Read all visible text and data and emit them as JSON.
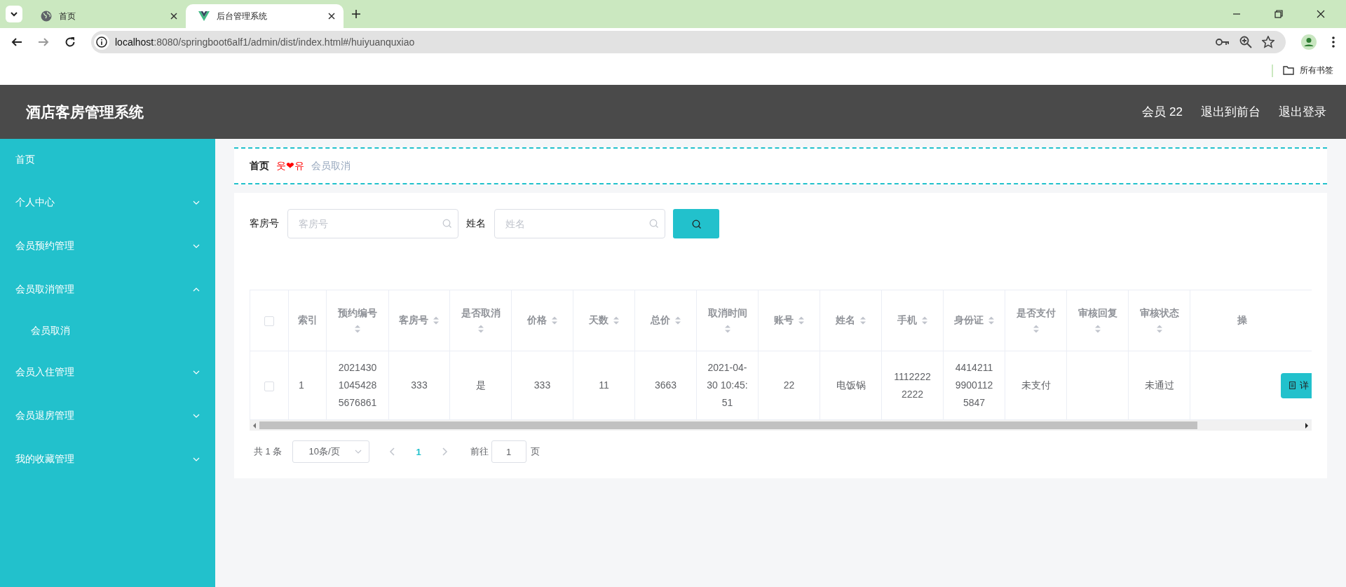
{
  "browser": {
    "tabs": [
      {
        "title": "首页",
        "selected": false
      },
      {
        "title": "后台管理系统",
        "selected": true
      }
    ],
    "url_host": "localhost",
    "url_path": ":8080/springboot6alf1/admin/dist/index.html#/huiyuanquxiao",
    "bookmarks": "所有书签"
  },
  "header": {
    "title": "酒店客房管理系统",
    "user": "会员 22",
    "links": [
      "退出到前台",
      "退出登录"
    ]
  },
  "sidebar": {
    "items": [
      {
        "label": "首页"
      },
      {
        "label": "个人中心",
        "expanded": false
      },
      {
        "label": "会员预约管理",
        "expanded": false
      },
      {
        "label": "会员取消管理",
        "expanded": true,
        "children": [
          {
            "label": "会员取消"
          }
        ]
      },
      {
        "label": "会员入住管理",
        "expanded": false
      },
      {
        "label": "会员退房管理",
        "expanded": false
      },
      {
        "label": "我的收藏管理",
        "expanded": false
      }
    ]
  },
  "breadcrumb": {
    "items": [
      "首页",
      "会员取消"
    ],
    "separator": "웃❤유"
  },
  "search": {
    "fields": [
      {
        "label": "客房号",
        "placeholder": "客房号"
      },
      {
        "label": "姓名",
        "placeholder": "姓名"
      }
    ]
  },
  "table": {
    "header_checkbox": {
      "checked": false
    },
    "columns": [
      {
        "label": "索引",
        "sortable": false
      },
      {
        "label": "预约编号",
        "sortable": true
      },
      {
        "label": "客房号",
        "sortable": true
      },
      {
        "label": "是否取消",
        "sortable": true
      },
      {
        "label": "价格",
        "sortable": true
      },
      {
        "label": "天数",
        "sortable": true
      },
      {
        "label": "总价",
        "sortable": true
      },
      {
        "label": "取消时间",
        "sortable": true
      },
      {
        "label": "账号",
        "sortable": true
      },
      {
        "label": "姓名",
        "sortable": true
      },
      {
        "label": "手机",
        "sortable": true
      },
      {
        "label": "身份证",
        "sortable": true
      },
      {
        "label": "是否支付",
        "sortable": true
      },
      {
        "label": "审核回复",
        "sortable": true
      },
      {
        "label": "审核状态",
        "sortable": true
      },
      {
        "label": "操",
        "sortable": false
      }
    ],
    "rows": [
      {
        "checked": false,
        "cells": [
          "1",
          "202143010454285676861",
          "333",
          "是",
          "333",
          "11",
          "3663",
          "2021-04-30 10:45:51",
          "22",
          "电饭锅",
          "11122222222",
          "441421199001125847",
          "未支付",
          "",
          "未通过"
        ],
        "action": "详"
      }
    ]
  },
  "pagination": {
    "total": "共 1 条",
    "page_size": "10条/页",
    "pages": [
      {
        "label": "1",
        "selected": true
      }
    ],
    "goto": "前往",
    "goto_value": "1",
    "page_unit": "页"
  }
}
